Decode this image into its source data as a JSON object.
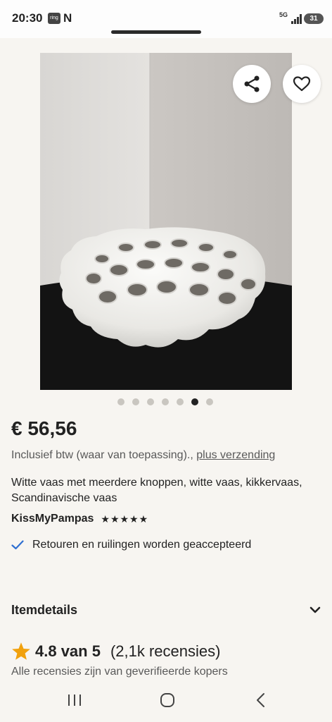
{
  "status_bar": {
    "time": "20:30",
    "ring_badge": "ring",
    "n_icon": "N",
    "network": "5G",
    "battery": "31"
  },
  "listing": {
    "image_count": 7,
    "active_image_index": 6,
    "price": "€ 56,56",
    "tax_note": "Inclusief btw (waar van toepassing).,",
    "shipping_link": "plus verzending",
    "title": "Witte vaas met meerdere knoppen, witte vaas, kikkervaas, Scandinavische vaas",
    "seller": "KissMyPampas",
    "seller_stars": "★★★★★",
    "returns": "Retouren en ruilingen worden geaccepteerd"
  },
  "item_details": {
    "label": "Itemdetails"
  },
  "reviews": {
    "rating": "4.8 van 5",
    "count": "(2,1k recensies)",
    "verified_note": "Alle recensies zijn van geverifieerde kopers"
  },
  "colors": {
    "background": "#f7f5f1",
    "text": "#222222",
    "secondary_text": "#595959",
    "star": "#f1a10d",
    "check": "#2f6fd1"
  },
  "icons": {
    "share": "share-icon",
    "favorite": "heart-icon",
    "chevron": "chevron-down-icon",
    "check": "check-icon",
    "star": "star-icon"
  }
}
